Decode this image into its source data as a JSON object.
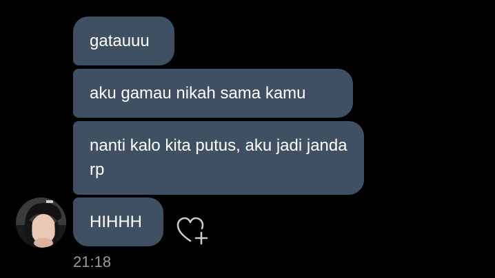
{
  "messages": [
    {
      "text": "gatauuu"
    },
    {
      "text": "aku gamau nikah sama kamu"
    },
    {
      "text": "nanti kalo kita putus, aku jadi janda rp"
    },
    {
      "text": "HIHHH"
    }
  ],
  "timestamp": "21:18",
  "icons": {
    "avatar": "profile-avatar",
    "react": "heart-plus-icon"
  },
  "colors": {
    "background": "#000000",
    "bubble": "#3f5063",
    "text": "#ffffff",
    "timestamp": "#9a9a9a"
  }
}
